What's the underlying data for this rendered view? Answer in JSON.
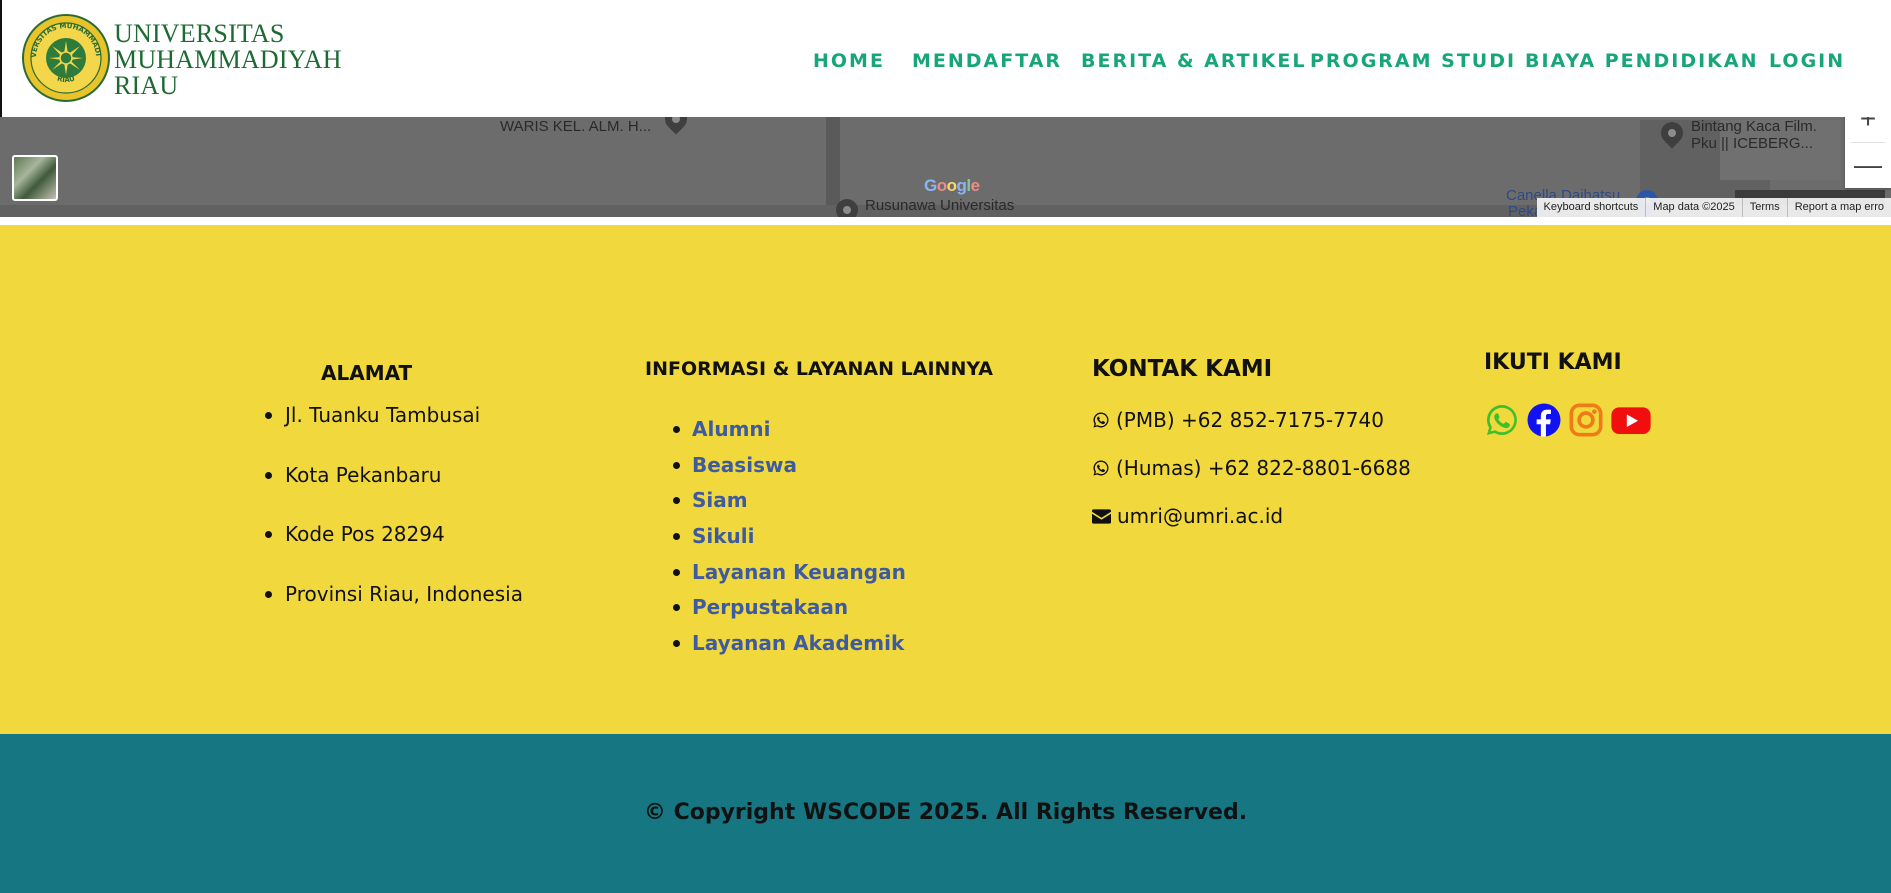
{
  "header": {
    "logo": {
      "line1": "UNIVERSITAS",
      "line2": "MUHAMMADIYAH",
      "line3": "RIAU",
      "seal_text_top": "UNIVERSITAS MUHAMMADIYAH",
      "seal_text_bottom": "RIAU"
    },
    "nav": [
      {
        "label": "HOME"
      },
      {
        "label": "MENDAFTAR"
      },
      {
        "label": "BERITA & ARTIKEL"
      },
      {
        "label": "PROGRAM STUDI"
      },
      {
        "label": "BIAYA PENDIDIKAN"
      },
      {
        "label": "LOGIN"
      }
    ],
    "colors": {
      "nav": "#17a67a",
      "logo_text": "#1d6a32"
    }
  },
  "map": {
    "pois": [
      {
        "label": "WARIS KEL. ALM. H..."
      },
      {
        "label": "Rusunawa Universitas"
      },
      {
        "label": "Bintang Kaca Film."
      },
      {
        "label": "Pku || ICEBERG..."
      },
      {
        "label": "Canella Daihatsu"
      },
      {
        "label": "Pekan"
      }
    ],
    "brand": "Google",
    "zoom": {
      "plus": "+",
      "minus": "—"
    },
    "attribution": {
      "shortcuts": "Keyboard shortcuts",
      "data": "Map data ©2025",
      "terms": "Terms",
      "report": "Report a map erro"
    }
  },
  "footer": {
    "alamat": {
      "title": "ALAMAT",
      "items": [
        "Jl. Tuanku Tambusai",
        "Kota Pekanbaru",
        "Kode Pos 28294",
        "Provinsi Riau, Indonesia"
      ]
    },
    "informasi": {
      "title": "INFORMASI & LAYANAN LAINNYA",
      "links": [
        "Alumni",
        "Beasiswa",
        "Siam",
        "Sikuli",
        "Layanan Keuangan",
        "Perpustakaan",
        "Layanan Akademik"
      ]
    },
    "kontak": {
      "title": "KONTAK KAMI",
      "pmb": "(PMB) +62 852-7175-7740",
      "humas": "(Humas) +62 822-8801-6688",
      "email": "umri@umri.ac.id"
    },
    "ikuti": {
      "title": "IKUTI KAMI",
      "icons": [
        "whatsapp-icon",
        "facebook-icon",
        "instagram-icon",
        "youtube-icon"
      ]
    },
    "copyright": "© Copyright WSCODE 2025. All Rights Reserved.",
    "colors": {
      "main_bg": "#f1d83d",
      "bar_bg": "#167783",
      "link": "#3e5b9f"
    }
  }
}
